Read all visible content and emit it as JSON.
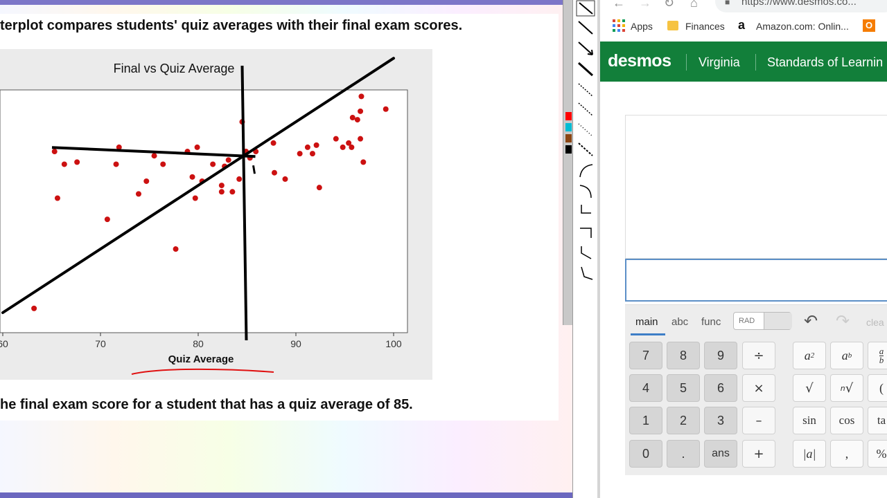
{
  "worksheet": {
    "question_top": "terplot compares students' quiz averages with their final exam scores.",
    "question_bottom": "he final exam score for a student that has a quiz average of 85."
  },
  "chart_data": {
    "type": "scatter",
    "title": "Final vs Quiz Average",
    "xlabel": "Quiz Average",
    "ylabel": "",
    "xlim": [
      60,
      101
    ],
    "ylim": [
      50,
      105
    ],
    "x_ticks": [
      "60",
      "70",
      "80",
      "90",
      "100"
    ],
    "grid": false,
    "points": [
      [
        63.2,
        51
      ],
      [
        65.3,
        88
      ],
      [
        65.6,
        77
      ],
      [
        66.3,
        85
      ],
      [
        67.6,
        85.5
      ],
      [
        70.7,
        72
      ],
      [
        71.9,
        89
      ],
      [
        71.6,
        85
      ],
      [
        73.9,
        78
      ],
      [
        74.7,
        81
      ],
      [
        75.5,
        87
      ],
      [
        76.4,
        85
      ],
      [
        77.7,
        65
      ],
      [
        78.9,
        88
      ],
      [
        79.4,
        82
      ],
      [
        79.7,
        77
      ],
      [
        79.9,
        89
      ],
      [
        80.4,
        81
      ],
      [
        81.5,
        85
      ],
      [
        82.4,
        78.5
      ],
      [
        82.4,
        80
      ],
      [
        82.7,
        84.5
      ],
      [
        83.1,
        86
      ],
      [
        83.5,
        78.5
      ],
      [
        84.2,
        81.5
      ],
      [
        84.5,
        95
      ],
      [
        84.9,
        88
      ],
      [
        85.3,
        86.5
      ],
      [
        85.9,
        88
      ],
      [
        87.7,
        90
      ],
      [
        87.8,
        83
      ],
      [
        88.9,
        81.5
      ],
      [
        90.4,
        87.5
      ],
      [
        91.2,
        89
      ],
      [
        91.7,
        87.5
      ],
      [
        92.1,
        89.5
      ],
      [
        92.4,
        79.5
      ],
      [
        94.1,
        91
      ],
      [
        94.8,
        89
      ],
      [
        95.4,
        90
      ],
      [
        95.7,
        89
      ],
      [
        95.8,
        96
      ],
      [
        96.3,
        95.5
      ],
      [
        96.6,
        97.5
      ],
      [
        96.6,
        91
      ],
      [
        96.9,
        85.5
      ],
      [
        96.7,
        101
      ],
      [
        99.2,
        98
      ]
    ],
    "annotations": {
      "regression_line": [
        [
          60,
          50
        ],
        [
          100,
          110
        ]
      ],
      "vertical_line_x": 85,
      "horizontal_line_y": 87
    }
  },
  "toolbar": {
    "swatch_colors": [
      "#ff0000",
      "#00bcd4",
      "#8b4513",
      "#000000"
    ]
  },
  "browser": {
    "url": "https://www.desmos.co...",
    "bookmarks": [
      "Apps",
      "Finances",
      "Amazon.com: Onlin...",
      "O"
    ]
  },
  "desmos": {
    "logo": "desmos",
    "nav": [
      "Virginia",
      "Standards of Learnin"
    ],
    "tabs": [
      "main",
      "abc",
      "func"
    ],
    "angle_mode": "RAD",
    "clear": "clea",
    "keys_numpad": [
      "7",
      "8",
      "9",
      "÷",
      "4",
      "5",
      "6",
      "×",
      "1",
      "2",
      "3",
      "–",
      "0",
      ".",
      "ans",
      "+"
    ],
    "keys_func": [
      "√",
      "sin",
      "cos",
      "ta",
      "|a|",
      ",",
      "%"
    ]
  },
  "colors": {
    "desmos_green": "#127f3a",
    "point_red": "#cc1111",
    "ink_red": "#e01010"
  }
}
